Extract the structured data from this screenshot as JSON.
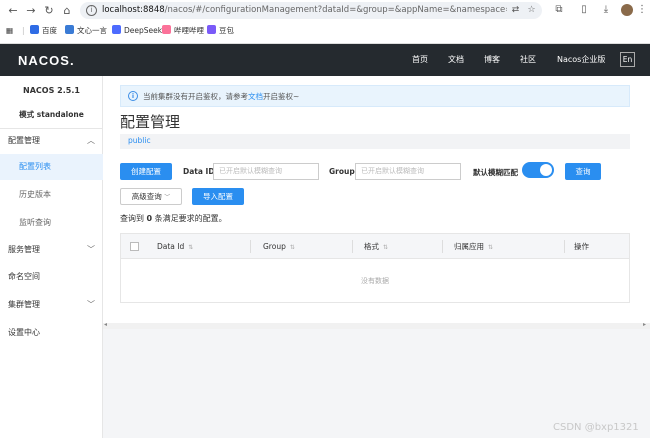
{
  "browser": {
    "url_host": "localhost:8848",
    "url_path": "/nacos/#/configurationManagement?dataId=&group=&appName=&namespace=&pageSize=&...",
    "bookmarks": [
      "百度",
      "文心一言",
      "DeepSeek",
      "哔哩哔哩",
      "豆包"
    ],
    "bookmark_colors": [
      "#2f6ce5",
      "#3a7bd5",
      "#4d6bfe",
      "#fb7299",
      "#7a5af8"
    ]
  },
  "header": {
    "logo": "NACOS.",
    "nav": [
      "首页",
      "文档",
      "博客",
      "社区",
      "Nacos企业版"
    ],
    "lang": "En"
  },
  "sidebar": {
    "title": "NACOS 2.5.1",
    "mode": "模式 standalone",
    "items": [
      {
        "label": "配置管理",
        "type": "group",
        "expanded": true
      },
      {
        "label": "配置列表",
        "type": "sub",
        "active": true
      },
      {
        "label": "历史版本",
        "type": "sub"
      },
      {
        "label": "监听查询",
        "type": "sub"
      },
      {
        "label": "服务管理",
        "type": "group"
      },
      {
        "label": "命名空间",
        "type": "plain"
      },
      {
        "label": "集群管理",
        "type": "group"
      },
      {
        "label": "设置中心",
        "type": "plain"
      }
    ]
  },
  "main": {
    "notice_prefix": "当前集群没有开启鉴权，请参考",
    "notice_link": "文档",
    "notice_suffix": "开启鉴权~",
    "title": "配置管理",
    "namespace": "public",
    "create_button": "创建配置",
    "dataid_label": "Data ID",
    "dataid_placeholder": "已开启默认模糊查询",
    "group_label": "Group",
    "group_placeholder": "已开启默认模糊查询",
    "fuzzy_label": "默认模糊匹配",
    "fuzzy_on": true,
    "query_button": "查询",
    "advanced_button": "高级查询",
    "import_button": "导入配置",
    "result_prefix": "查询到",
    "result_count": "0",
    "result_suffix": "条满足要求的配置。",
    "columns": [
      "Data Id",
      "Group",
      "格式",
      "归属应用",
      "操作"
    ],
    "empty_text": "没有数据"
  },
  "watermark": "CSDN @bxp1321"
}
